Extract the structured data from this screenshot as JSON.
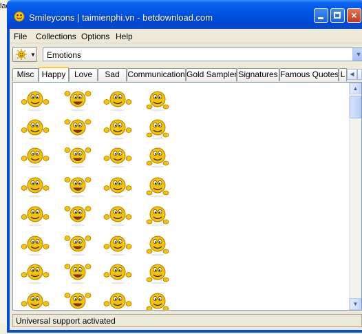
{
  "background": {
    "label": "lace"
  },
  "window": {
    "title": "Smileycons | taimienphi.vn - betdownload.com",
    "buttons": {
      "minimize": "minimize",
      "maximize": "maximize",
      "close": "×"
    }
  },
  "menu": [
    "File",
    "Collections",
    "Options",
    "Help"
  ],
  "toolbar": {
    "collection_value": "Emotions"
  },
  "tabs": [
    "Misc",
    "Happy",
    "Love",
    "Sad",
    "Communication",
    "Gold Sampler",
    "Signatures",
    "Famous Quotes",
    "L"
  ],
  "active_tab": "Happy",
  "smileys": {
    "columns": 4,
    "rows": 8,
    "count": 32,
    "color": "#f5c400"
  },
  "status": "Universal support activated",
  "colors": {
    "titlebar": "#0054e3",
    "chrome": "#ece9d8",
    "active_tab_accent": "#ffc83c",
    "smiley_yellow": "#f5c400"
  }
}
